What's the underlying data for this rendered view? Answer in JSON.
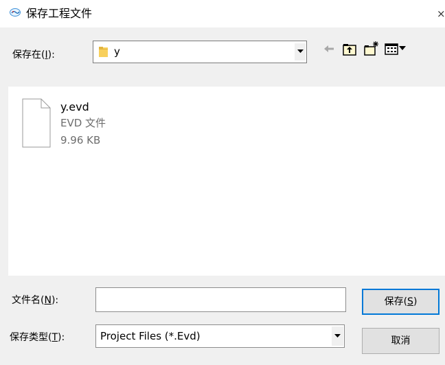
{
  "window": {
    "title": "保存工程文件",
    "close_glyph": "×"
  },
  "toolbar": {
    "save_in_label": "保存在",
    "save_in_hotkey": "I",
    "location_value": "y",
    "icons": [
      "back-arrow-icon",
      "up-folder-icon",
      "new-folder-icon",
      "view-menu-icon"
    ]
  },
  "file_list": {
    "items": [
      {
        "name": "y.evd",
        "type": "EVD 文件",
        "size": "9.96 KB"
      }
    ]
  },
  "form": {
    "filename_label": "文件名",
    "filename_hotkey": "N",
    "filename_value": "",
    "filetype_label": "保存类型",
    "filetype_hotkey": "T",
    "filetype_value": "Project Files (*.Evd)"
  },
  "buttons": {
    "save_label": "保存",
    "save_hotkey": "S",
    "cancel_label": "取消"
  },
  "colors": {
    "dialog_bg": "#f0f0f0",
    "folder_yellow": "#f8d05d",
    "default_button_border": "#0078d7"
  }
}
